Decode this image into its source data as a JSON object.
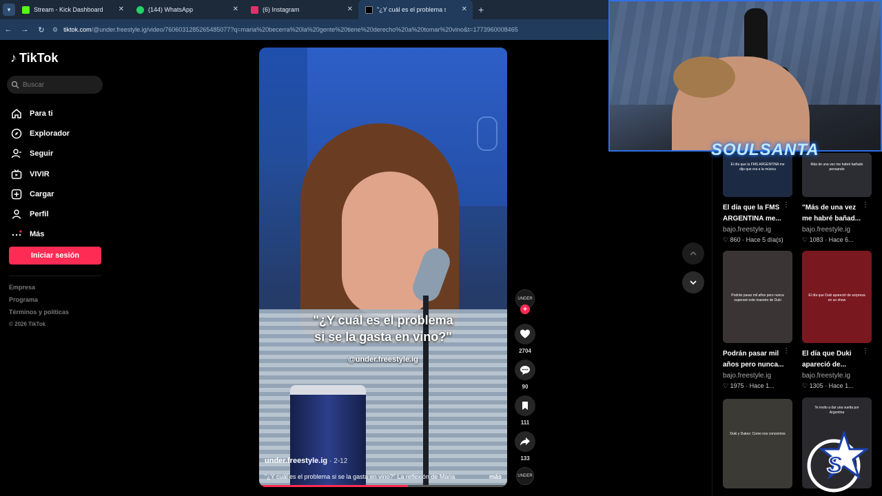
{
  "browser": {
    "tabs": [
      {
        "label": "Stream - Kick Dashboard",
        "color": "#53fc18"
      },
      {
        "label": "(144) WhatsApp",
        "color": "#25d366"
      },
      {
        "label": "(6) Instagram",
        "color": "#e1306c"
      },
      {
        "label": "\"¿Y cuál es el problema si se",
        "color": "#000000"
      }
    ],
    "url_host": "tiktok.com",
    "url_path": "/@under.freestyle.ig/video/7606031285265485077?q=maria%20becerra%20la%20gente%20tiene%20derecho%20a%20tomar%20vino&t=1773960008465"
  },
  "sidebar": {
    "brand": "TikTok",
    "search_placeholder": "Buscar",
    "nav": [
      {
        "label": "Para ti",
        "icon": "home-icon"
      },
      {
        "label": "Explorador",
        "icon": "compass-icon"
      },
      {
        "label": "Seguir",
        "icon": "user-follow-icon"
      },
      {
        "label": "VIVIR",
        "icon": "live-icon"
      },
      {
        "label": "Cargar",
        "icon": "upload-icon"
      },
      {
        "label": "Perfil",
        "icon": "profile-icon"
      },
      {
        "label": "Más",
        "icon": "more-icon"
      }
    ],
    "login_label": "Iniciar sesión",
    "footer": [
      "Empresa",
      "Programa",
      "Términos y políticas"
    ],
    "copyright": "© 2026 TikTok"
  },
  "video": {
    "caption_line1": "\"¿Y cuál es el problema",
    "caption_line2": "si se la gasta en vino?\"",
    "watermark": "@under.freestyle.ig",
    "author": "under.freestyle.ig",
    "date": "· 2-12",
    "description": "\"¿Y cuál es el problema si se la gasta en vino?\" La reflexión de Maria",
    "more_label": "más",
    "progress": 0.6
  },
  "actions": {
    "avatar_text": "UNDER",
    "likes": "2704",
    "comments": "90",
    "saves": "111",
    "shares": "133"
  },
  "overlay": {
    "streamer_name": "SOULSANTA"
  },
  "related": [
    {
      "title1": "El día que la FMS",
      "title2": "ARGENTINA me...",
      "channel": "bajo.freestyle.ig",
      "likes": "860",
      "time": "Hace 5 día(s)",
      "thumb_text": "El día que la FMS ARGENTINA me dijo que era a la música",
      "bg": "#1d2a44"
    },
    {
      "title1": "\"Más de una vez",
      "title2": "me habré bañad...",
      "channel": "bajo.freestyle.ig",
      "likes": "1083",
      "time": "Hace 6...",
      "thumb_text": "Más de una vez me habré bañado pensando",
      "bg": "#2b2d33"
    },
    {
      "title1": "Podrán pasar mil",
      "title2": "años pero nunca...",
      "channel": "bajo.freestyle.ig",
      "likes": "1975",
      "time": "Hace 1...",
      "thumb_text": "Podrán pasar mil años pero nunca superaré este maestro de Duki",
      "bg": "#3a3434"
    },
    {
      "title1": "El día que Duki",
      "title2": "apareció de...",
      "channel": "bajo.freestyle.ig",
      "likes": "1305",
      "time": "Hace 1...",
      "thumb_text": "El día que Duki apareció de sorpresa en un show",
      "bg": "#7a1820"
    },
    {
      "title1": "",
      "title2": "",
      "channel": "",
      "likes": "",
      "time": "",
      "thumb_text": "Duki y Dukex: Como nos conocimos",
      "bg": "#3b3a35"
    },
    {
      "title1": "",
      "title2": "",
      "channel": "",
      "likes": "",
      "time": "",
      "thumb_text": "Te invito a dar una vuelta por Argentina",
      "bg": "#2a2a2e"
    }
  ]
}
